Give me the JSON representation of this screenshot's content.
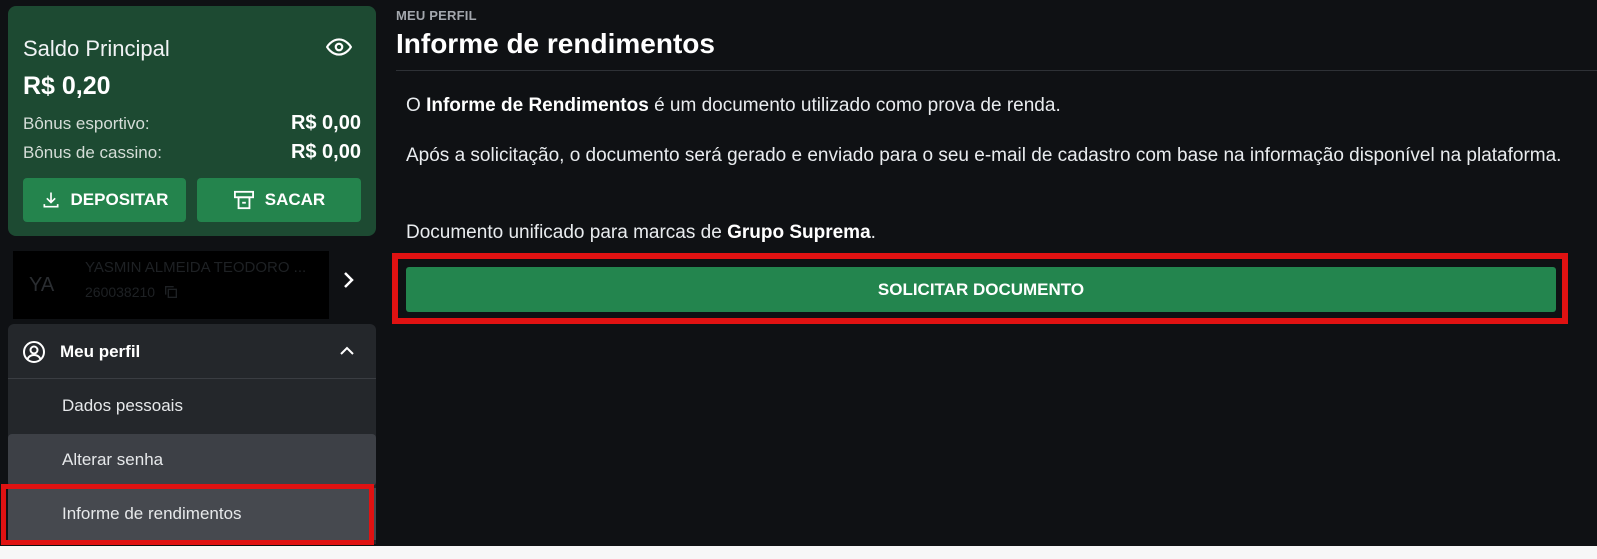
{
  "balance": {
    "title": "Saldo Principal",
    "amount": "R$ 0,20",
    "eye_icon": "eye-icon",
    "bonuses": [
      {
        "label": "Bônus esportivo:",
        "value": "R$ 0,00"
      },
      {
        "label": "Bônus de cassino:",
        "value": "R$ 0,00"
      }
    ],
    "deposit_label": "DEPOSITAR",
    "withdraw_label": "SACAR"
  },
  "user": {
    "initials": "YA",
    "name": "YASMIN ALMEIDA TEODORO ...",
    "id": "260038210"
  },
  "menu": {
    "section_label": "Meu perfil",
    "items": [
      "Dados pessoais",
      "Alterar senha",
      "Informe de rendimentos"
    ]
  },
  "main": {
    "breadcrumb": "MEU PERFIL",
    "title": "Informe de rendimentos",
    "p1": {
      "pre": "O ",
      "bold": "Informe de Rendimentos",
      "post": " é um documento utilizado como prova de renda."
    },
    "p2": "Após a solicitação, o documento será gerado e enviado para o seu e-mail de cadastro com base na informação disponível na plataforma.",
    "p3": {
      "pre": "Documento unificado para marcas de ",
      "bold": "Grupo Suprema",
      "post": "."
    },
    "button_label": "SOLICITAR DOCUMENTO"
  },
  "colors": {
    "brand_green": "#24844d",
    "card_green": "#1d4a32",
    "highlight": "#e01212",
    "background": "#0f1114"
  }
}
